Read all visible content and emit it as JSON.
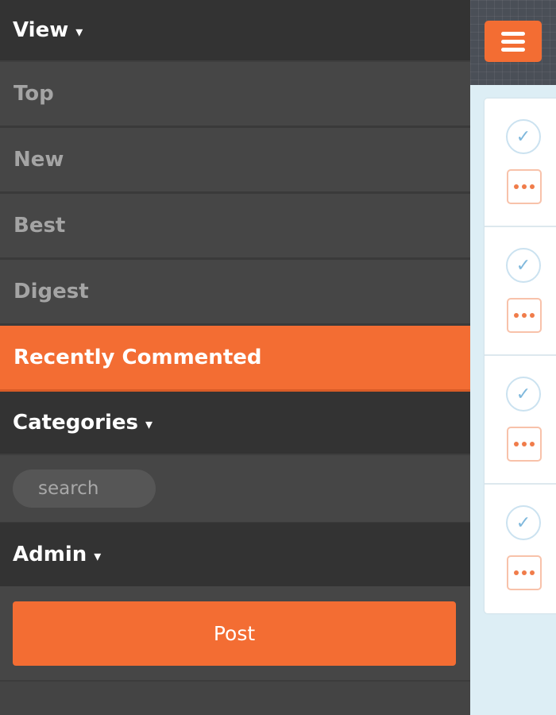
{
  "sidebar": {
    "view_header": {
      "label": "View",
      "caret": "▾"
    },
    "nav_items": [
      {
        "label": "Top",
        "active": false
      },
      {
        "label": "New",
        "active": false
      },
      {
        "label": "Best",
        "active": false
      },
      {
        "label": "Digest",
        "active": false
      },
      {
        "label": "Recently Commented",
        "active": true
      }
    ],
    "categories_header": {
      "label": "Categories",
      "caret": "▾"
    },
    "search": {
      "placeholder": "search",
      "value": ""
    },
    "admin_header": {
      "label": "Admin",
      "caret": "▾"
    },
    "post_button": {
      "label": "Post"
    }
  },
  "content": {
    "menu_icon": "hamburger-menu-icon",
    "post_cards": [
      {
        "check_icon": "check-icon",
        "more_icon": "more-dots-icon"
      },
      {
        "check_icon": "check-icon",
        "more_icon": "more-dots-icon"
      },
      {
        "check_icon": "check-icon",
        "more_icon": "more-dots-icon"
      },
      {
        "check_icon": "check-icon",
        "more_icon": "more-dots-icon"
      }
    ]
  },
  "colors": {
    "accent": "#f36d33",
    "sidebar_dark": "#333333",
    "sidebar_item": "#464646",
    "content_bg": "#ddeef5"
  }
}
